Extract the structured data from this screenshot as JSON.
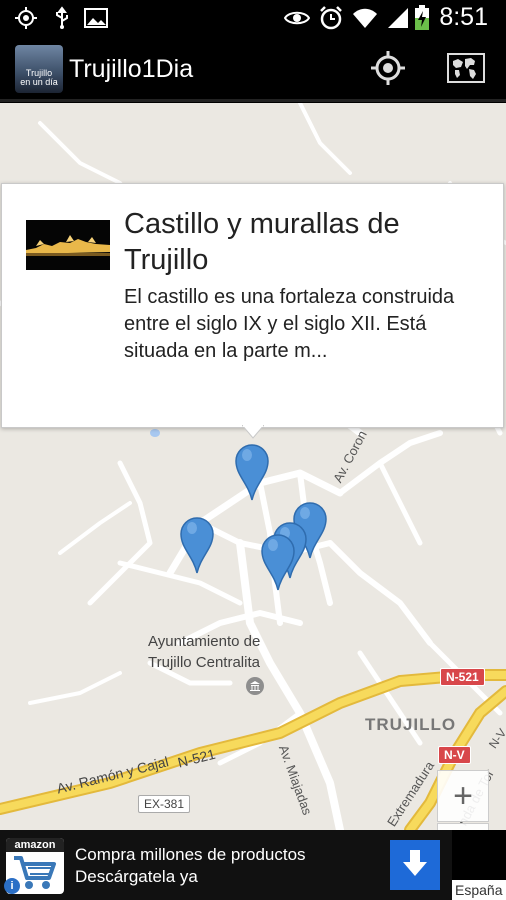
{
  "status_bar": {
    "time": "8:51",
    "icons": [
      "gps-icon",
      "usb-icon",
      "image-icon",
      "eye-icon",
      "alarm-icon",
      "wifi-icon",
      "signal-icon",
      "battery-charging-icon"
    ]
  },
  "action_bar": {
    "app_title": "Trujillo1Dia",
    "logo_text_line1": "Trujillo",
    "logo_text_line2": "en un día",
    "my_location_icon": "my-location-icon",
    "map_type_icon": "world-map-icon"
  },
  "info_window": {
    "title": "Castillo y murallas de Trujillo",
    "description": "El castillo es una fortaleza construida entre el siglo IX y el siglo XII. Está situada en la parte m..."
  },
  "map": {
    "labels": {
      "ayuntamiento_line1": "Ayuntamiento de",
      "ayuntamiento_line2": "Trujillo Centralita",
      "town": "TRUJILLO",
      "av_ramon": "Av. Ramón y Cajal",
      "n521_inline": "N-521",
      "av_miajadas": "Av. Miajadas",
      "av_coron": "Av. Coron",
      "extremadura": "Extremadura",
      "ronda": "nda de Tor",
      "nv_inline": "N-V"
    },
    "shields": {
      "n521": "N-521",
      "nv": "N-V",
      "ex381": "EX-381"
    },
    "zoom_in_label": "+",
    "zoom_out_label": "−",
    "marker_color": "#4a8fd6"
  },
  "ad": {
    "brand": "amazon",
    "line1": "Compra millones de productos",
    "line2": "Descárgatela ya",
    "info_label": "i"
  },
  "credit": "España"
}
